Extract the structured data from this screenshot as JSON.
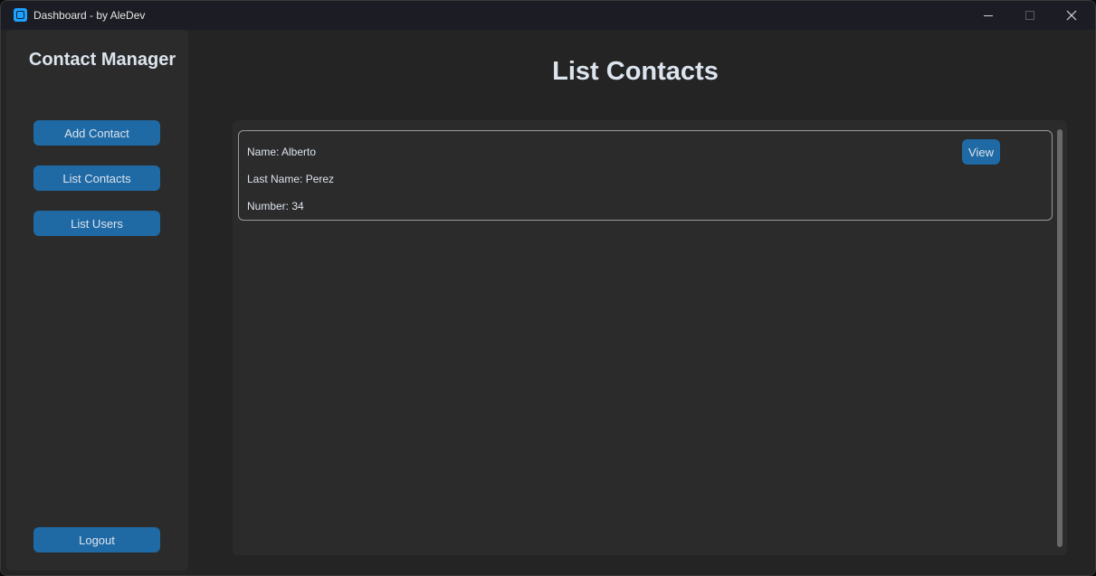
{
  "window": {
    "title": "Dashboard - by AleDev"
  },
  "sidebar": {
    "title": "Contact Manager",
    "items": [
      {
        "label": "Add Contact"
      },
      {
        "label": "List Contacts"
      },
      {
        "label": "List Users"
      }
    ],
    "logout_label": "Logout"
  },
  "main": {
    "title": "List Contacts",
    "contacts": [
      {
        "name": "Name: Alberto",
        "last_name": "Last Name: Perez",
        "number": "Number: 34",
        "view_label": "View"
      }
    ]
  },
  "colors": {
    "accent": "#1f6aa5",
    "panel": "#2b2b2b",
    "background": "#242424"
  }
}
